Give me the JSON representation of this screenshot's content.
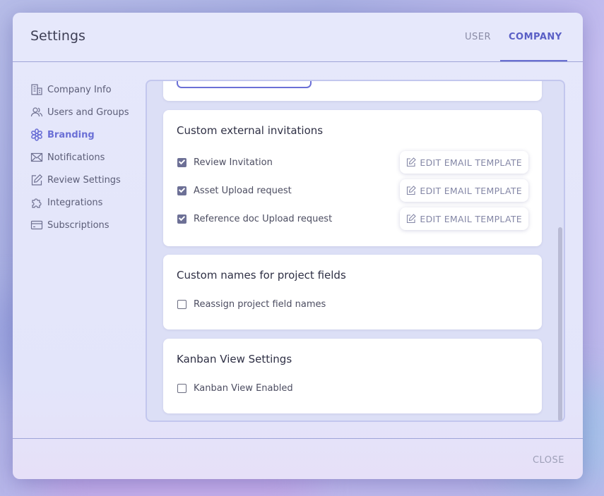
{
  "header": {
    "title": "Settings",
    "tabs": {
      "user": "USER",
      "company": "COMPANY"
    },
    "active_tab": "COMPANY"
  },
  "nav": {
    "items": [
      {
        "label": "Company Info",
        "icon": "building-icon"
      },
      {
        "label": "Users and Groups",
        "icon": "users-icon"
      },
      {
        "label": "Branding",
        "icon": "flower-icon",
        "active": true
      },
      {
        "label": "Notifications",
        "icon": "envelope-icon"
      },
      {
        "label": "Review Settings",
        "icon": "edit-icon"
      },
      {
        "label": "Integrations",
        "icon": "puzzle-icon"
      },
      {
        "label": "Subscriptions",
        "icon": "card-icon"
      }
    ]
  },
  "invitations": {
    "title": "Custom external invitations",
    "rows": [
      {
        "label": "Review Invitation",
        "checked": true,
        "button": "EDIT EMAIL TEMPLATE"
      },
      {
        "label": "Asset Upload request",
        "checked": true,
        "button": "EDIT EMAIL TEMPLATE"
      },
      {
        "label": "Reference doc Upload request",
        "checked": true,
        "button": "EDIT EMAIL TEMPLATE"
      }
    ]
  },
  "project_fields": {
    "title": "Custom names for project fields",
    "option": {
      "label": "Reassign project field names",
      "checked": false
    }
  },
  "kanban": {
    "title": "Kanban View Settings",
    "option": {
      "label": "Kanban View Enabled",
      "checked": false
    }
  },
  "footer": {
    "close_label": "CLOSE"
  },
  "colors": {
    "accent": "#6b70d6",
    "text": "#4c4d61",
    "muted": "#8487a6"
  }
}
